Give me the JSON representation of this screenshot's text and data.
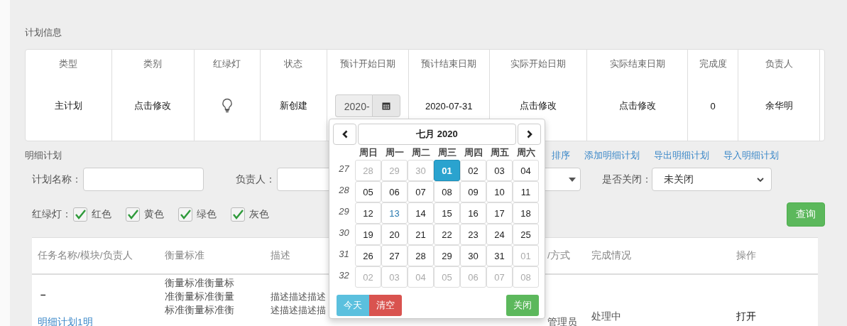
{
  "section_title": "计划信息",
  "plan_info": {
    "columns": [
      "类型",
      "类别",
      "红绿灯",
      "状态",
      "预计开始日期",
      "预计结束日期",
      "实际开始日期",
      "实际结束日期",
      "完成度",
      "负责人"
    ],
    "values": [
      {
        "kind": "text",
        "text": "主计划"
      },
      {
        "kind": "text",
        "text": "点击修改"
      },
      {
        "kind": "bulb"
      },
      {
        "kind": "text",
        "text": "新创建"
      },
      {
        "kind": "date_input",
        "text": "2020-"
      },
      {
        "kind": "text",
        "text": "2020-07-31"
      },
      {
        "kind": "text",
        "text": "点击修改"
      },
      {
        "kind": "text",
        "text": "点击修改"
      },
      {
        "kind": "text",
        "text": "0"
      },
      {
        "kind": "text",
        "text": "余华明"
      }
    ]
  },
  "detail_title": "明细计划",
  "actions": [
    "排序",
    "添加明细计划",
    "导出明细计划",
    "导入明细计划"
  ],
  "filters": {
    "plan_name": {
      "label": "计划名称："
    },
    "owner": {
      "label": "负责人："
    },
    "closed": {
      "label": "是否关闭：",
      "value": "未关闭"
    }
  },
  "traffic_light": {
    "label": "红绿灯：",
    "options": [
      {
        "label": "红色",
        "checked": true
      },
      {
        "label": "黄色",
        "checked": true
      },
      {
        "label": "绿色",
        "checked": true
      },
      {
        "label": "灰色",
        "checked": true
      }
    ]
  },
  "query_button": "查询",
  "table": {
    "columns": [
      "任务名称/模块/负责人",
      "衡量标准",
      "描述",
      "",
      "/方式",
      "完成情况",
      "操作"
    ],
    "rows": [
      {
        "name_mark": "−",
        "name_link": "明细计划1明",
        "criteria": [
          "衡量标准衡量标",
          "准衡量标准衡量",
          "标准衡量标准衡"
        ],
        "description": [
          "描述描述描述",
          "述描述描述描"
        ],
        "person": "管理员",
        "progress": "处理中",
        "action": "打开"
      }
    ]
  },
  "datepicker": {
    "title": "七月 2020",
    "weekdays": [
      "周日",
      "周一",
      "周二",
      "周三",
      "周四",
      "周五",
      "周六"
    ],
    "weeks": [
      {
        "number": "27",
        "days": [
          {
            "text": "28",
            "kind": "other",
            "selected": false
          },
          {
            "text": "29",
            "kind": "other",
            "selected": false
          },
          {
            "text": "30",
            "kind": "other",
            "selected": false
          },
          {
            "text": "01",
            "kind": "current",
            "selected": true
          },
          {
            "text": "02",
            "kind": "current",
            "selected": false
          },
          {
            "text": "03",
            "kind": "current",
            "selected": false
          },
          {
            "text": "04",
            "kind": "current",
            "selected": false
          }
        ]
      },
      {
        "number": "28",
        "days": [
          {
            "text": "05",
            "kind": "current",
            "selected": false
          },
          {
            "text": "06",
            "kind": "current",
            "selected": false
          },
          {
            "text": "07",
            "kind": "current",
            "selected": false
          },
          {
            "text": "08",
            "kind": "current",
            "selected": false
          },
          {
            "text": "09",
            "kind": "current",
            "selected": false
          },
          {
            "text": "10",
            "kind": "current",
            "selected": false
          },
          {
            "text": "11",
            "kind": "current",
            "selected": false
          }
        ]
      },
      {
        "number": "29",
        "days": [
          {
            "text": "12",
            "kind": "current",
            "selected": false
          },
          {
            "text": "13",
            "kind": "today",
            "selected": false
          },
          {
            "text": "14",
            "kind": "current",
            "selected": false
          },
          {
            "text": "15",
            "kind": "current",
            "selected": false
          },
          {
            "text": "16",
            "kind": "current",
            "selected": false
          },
          {
            "text": "17",
            "kind": "current",
            "selected": false
          },
          {
            "text": "18",
            "kind": "current",
            "selected": false
          }
        ]
      },
      {
        "number": "30",
        "days": [
          {
            "text": "19",
            "kind": "current",
            "selected": false
          },
          {
            "text": "20",
            "kind": "current",
            "selected": false
          },
          {
            "text": "21",
            "kind": "current",
            "selected": false
          },
          {
            "text": "22",
            "kind": "current",
            "selected": false
          },
          {
            "text": "23",
            "kind": "current",
            "selected": false
          },
          {
            "text": "24",
            "kind": "current",
            "selected": false
          },
          {
            "text": "25",
            "kind": "current",
            "selected": false
          }
        ]
      },
      {
        "number": "31",
        "days": [
          {
            "text": "26",
            "kind": "current",
            "selected": false
          },
          {
            "text": "27",
            "kind": "current",
            "selected": false
          },
          {
            "text": "28",
            "kind": "current",
            "selected": false
          },
          {
            "text": "29",
            "kind": "current",
            "selected": false
          },
          {
            "text": "30",
            "kind": "current",
            "selected": false
          },
          {
            "text": "31",
            "kind": "current",
            "selected": false
          },
          {
            "text": "01",
            "kind": "other",
            "selected": false
          }
        ]
      },
      {
        "number": "32",
        "days": [
          {
            "text": "02",
            "kind": "other",
            "selected": false
          },
          {
            "text": "03",
            "kind": "other",
            "selected": false
          },
          {
            "text": "04",
            "kind": "other",
            "selected": false
          },
          {
            "text": "05",
            "kind": "other",
            "selected": false
          },
          {
            "text": "06",
            "kind": "other",
            "selected": false
          },
          {
            "text": "07",
            "kind": "other",
            "selected": false
          },
          {
            "text": "08",
            "kind": "other",
            "selected": false
          }
        ]
      }
    ],
    "buttons": [
      {
        "label": "今天",
        "kind": "info"
      },
      {
        "label": "清空",
        "kind": "danger"
      },
      {
        "label": "关闭",
        "kind": "success"
      }
    ]
  }
}
